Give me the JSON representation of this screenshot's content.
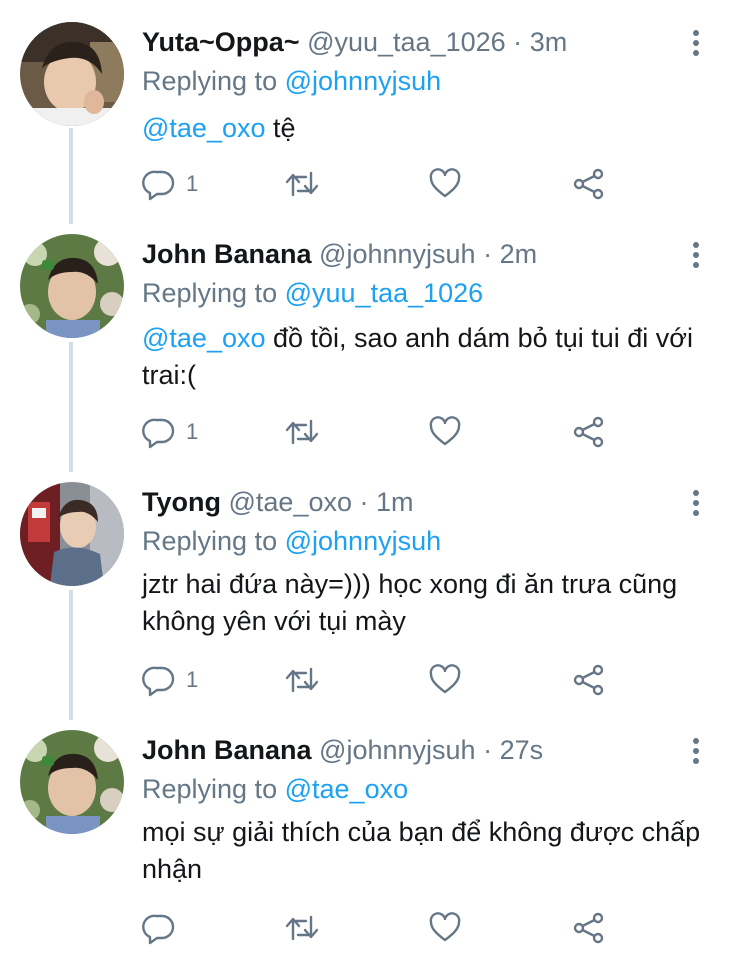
{
  "tweets": [
    {
      "name": "Yuta~Oppa~",
      "handle": "@yuu_taa_1026",
      "time": "3m",
      "reply_prefix": "Replying to",
      "reply_to": "@johnnyjsuh",
      "mention": "@tae_oxo",
      "text": " tệ",
      "reply_count": "1",
      "avatar": "yuta"
    },
    {
      "name": "John Banana",
      "handle": "@johnnyjsuh",
      "time": "2m",
      "reply_prefix": "Replying to",
      "reply_to": "@yuu_taa_1026",
      "mention": "@tae_oxo",
      "text": " đồ tồi, sao anh dám bỏ tụi tui đi với trai:(",
      "reply_count": "1",
      "avatar": "john"
    },
    {
      "name": "Tyong",
      "handle": "@tae_oxo",
      "time": "1m",
      "reply_prefix": "Replying to",
      "reply_to": "@johnnyjsuh",
      "mention": "",
      "text": "jztr hai đứa này=))) học xong đi ăn trưa cũng không yên với tụi mày",
      "reply_count": "1",
      "avatar": "tyong"
    },
    {
      "name": "John Banana",
      "handle": "@johnnyjsuh",
      "time": "27s",
      "reply_prefix": "Replying to",
      "reply_to": "@tae_oxo",
      "mention": "",
      "text": "mọi sự giải thích của bạn để không được chấp nhận",
      "reply_count": "",
      "avatar": "john"
    }
  ],
  "separator": "·",
  "colors": {
    "link": "#1da1f2",
    "muted": "#657786",
    "text": "#14171a",
    "thread_line": "#d6dde3"
  },
  "icons": {
    "reply": "reply-icon",
    "retweet": "retweet-icon",
    "like": "heart-icon",
    "share": "share-icon",
    "more": "more-vertical-icon"
  }
}
